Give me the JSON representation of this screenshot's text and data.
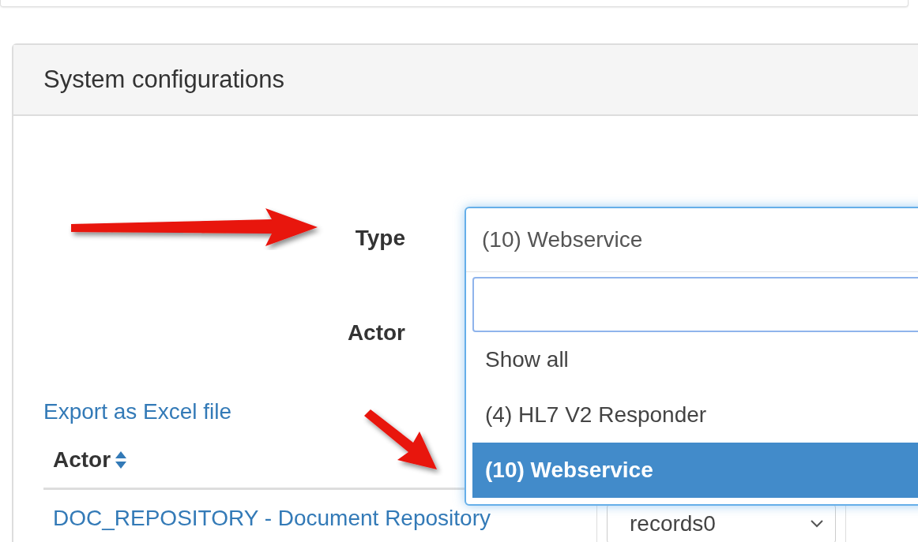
{
  "panel": {
    "title": "System configurations"
  },
  "filters": [
    {
      "label": "Type",
      "value": "(10) Webservice",
      "expanded": true,
      "options": [
        {
          "label": "Show all",
          "selected": false
        },
        {
          "label": "(4) HL7 V2 Responder",
          "selected": false
        },
        {
          "label": "(10) Webservice",
          "selected": true
        }
      ]
    },
    {
      "label": "Actor"
    }
  ],
  "export_link": "Export as Excel file",
  "table": {
    "columns": [
      {
        "label": "Actor",
        "sortable": true
      }
    ],
    "rows": [
      {
        "actor": "DOC_REPOSITORY - Document Repository",
        "column_2": "records0"
      }
    ]
  }
}
